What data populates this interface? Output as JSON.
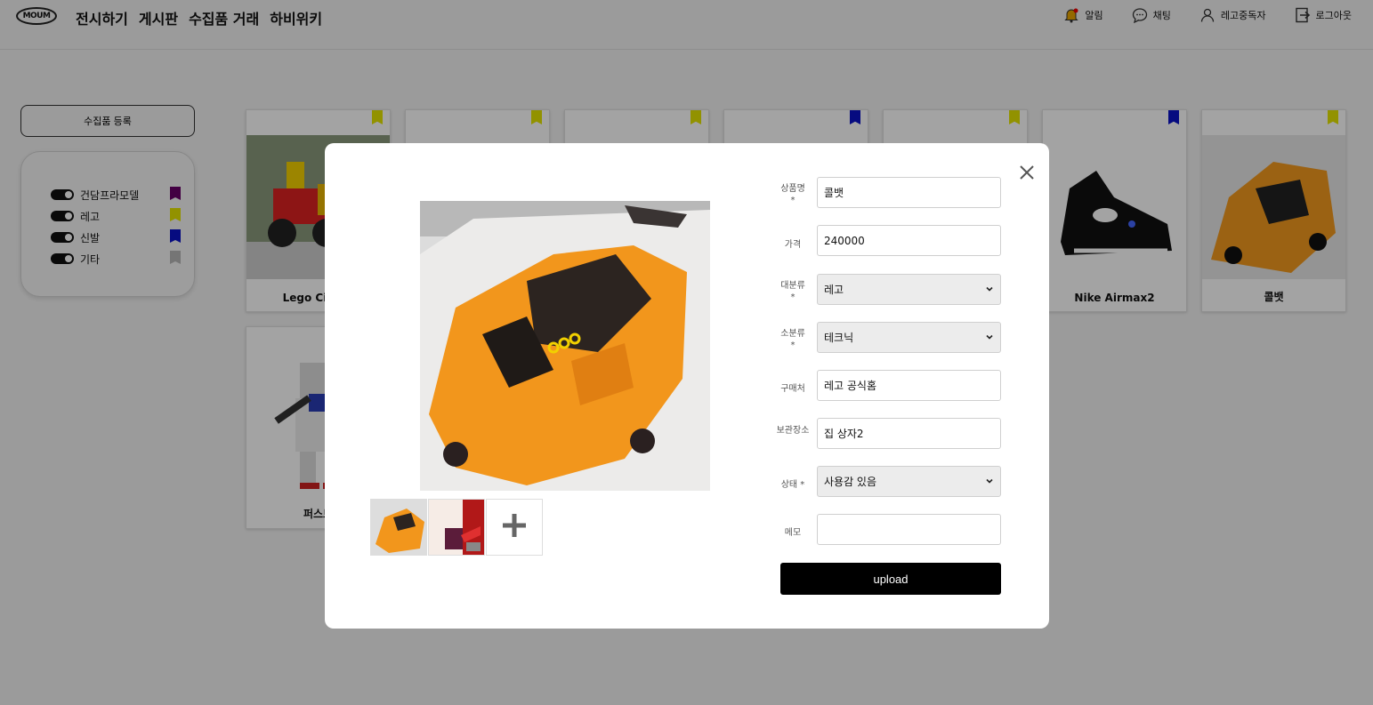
{
  "header": {
    "logo": "MOUM",
    "nav": [
      "전시하기",
      "게시판",
      "수집품 거래",
      "하비위키"
    ],
    "alarm": "알림",
    "chat": "채팅",
    "user": "레고중독자",
    "logout": "로그아웃"
  },
  "sidebar": {
    "register_button": "수집품 등록",
    "filters": [
      {
        "label": "건담프라모델",
        "color": "#6a006a"
      },
      {
        "label": "레고",
        "color": "#e4e400"
      },
      {
        "label": "신발",
        "color": "#0a12c8"
      },
      {
        "label": "기타",
        "color": "#b8b8b8"
      }
    ]
  },
  "cards": {
    "c1_title": "Lego City Fi",
    "c6_title": "Nike Airmax2",
    "c7_title": "콜뱃",
    "c8_title": "퍼스트",
    "flag_colors": [
      "#e4e400",
      "#e4e400",
      "#e4e400",
      "#0a12c8",
      "#e4e400",
      "#0a12c8",
      "#e4e400"
    ]
  },
  "modal": {
    "fields": {
      "name": {
        "label": "상품명",
        "required": "*",
        "value": "콜뱃"
      },
      "price": {
        "label": "가격",
        "value": "240000"
      },
      "category": {
        "label": "대분류",
        "required": "*",
        "value": "레고"
      },
      "subcategory": {
        "label": "소분류",
        "required": "*",
        "value": "테크닉"
      },
      "place": {
        "label": "구매처",
        "value": "레고 공식홈"
      },
      "storage": {
        "label": "보관장소",
        "value": "집 상자2"
      },
      "condition": {
        "label": "상태 *",
        "value": "사용감 있음"
      },
      "memo": {
        "label": "메모",
        "value": ""
      }
    },
    "upload_label": "upload"
  }
}
